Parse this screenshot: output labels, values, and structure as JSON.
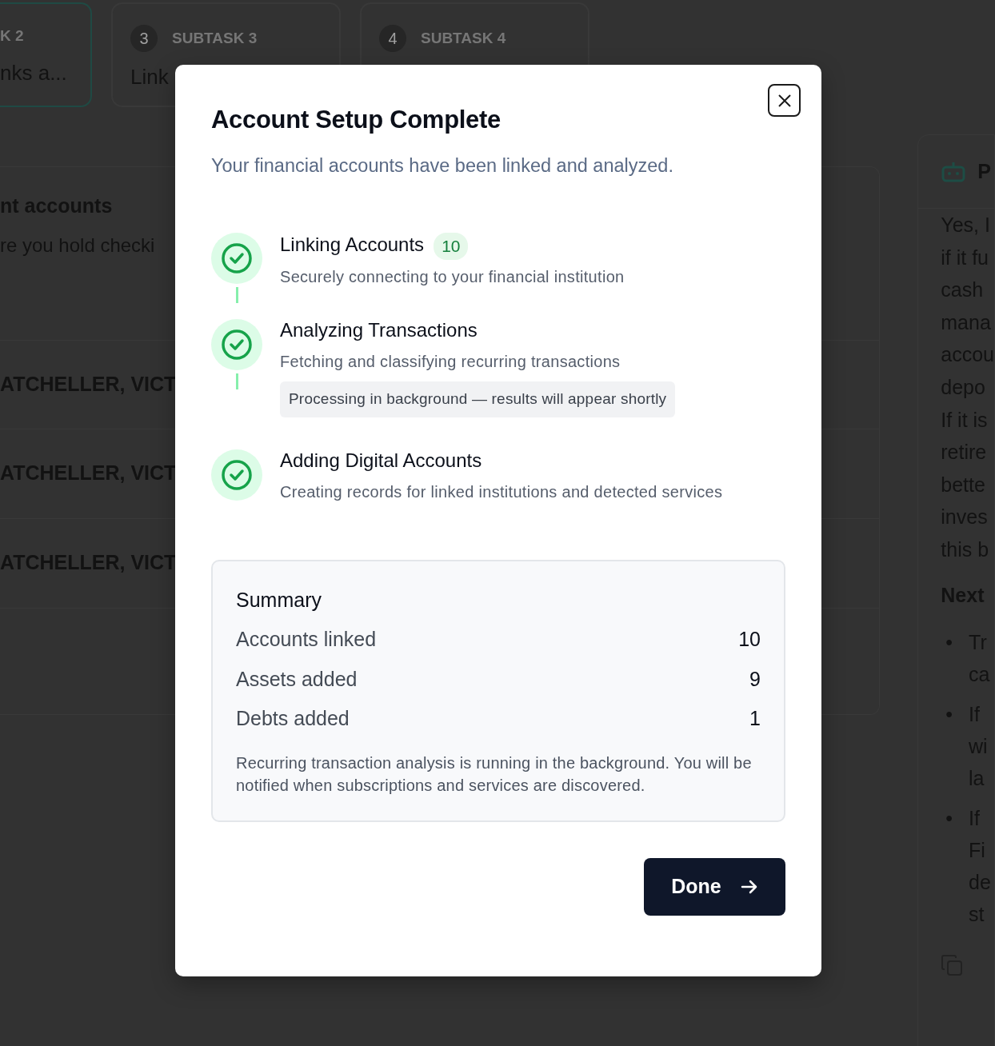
{
  "background": {
    "subtasks": [
      {
        "label": "K 2",
        "title": "nks a...",
        "selected": true
      },
      {
        "number": "3",
        "label": "SUBTASK 3",
        "title": "Link",
        "selected": false
      },
      {
        "number": "4",
        "label": "SUBTASK 4",
        "selected": false
      }
    ],
    "section": {
      "title": "nt accounts",
      "description": "re you hold checki"
    },
    "rows": [
      "ATCHELLER, VICT",
      "ATCHELLER, VICT",
      "ATCHELLER, VICT"
    ],
    "chat": {
      "title": "P",
      "paragraph_lines": [
        "Yes, I",
        "if it fu",
        "cash",
        "mana",
        "accou",
        "depo",
        "If it is",
        "retire",
        "bette",
        "inves",
        "this b"
      ],
      "heading": "Next",
      "bullets": [
        {
          "marker": "•",
          "lines": [
            "Tr",
            "ca"
          ]
        },
        {
          "marker": "•",
          "lines": [
            "If",
            "wi",
            "la"
          ]
        },
        {
          "marker": "•",
          "lines": [
            "If",
            "Fi",
            "de",
            "st"
          ]
        }
      ]
    }
  },
  "modal": {
    "title": "Account Setup Complete",
    "subtitle": "Your financial accounts have been linked and analyzed.",
    "steps": [
      {
        "title": "Linking Accounts",
        "count": "10",
        "description": "Securely connecting to your financial institution",
        "done": true
      },
      {
        "title": "Analyzing Transactions",
        "description": "Fetching and classifying recurring transactions",
        "note": "Processing in background — results will appear shortly",
        "done": true
      },
      {
        "title": "Adding Digital Accounts",
        "description": "Creating records for linked institutions and detected services",
        "done": true
      }
    ],
    "summary": {
      "title": "Summary",
      "rows": [
        {
          "label": "Accounts linked",
          "value": "10"
        },
        {
          "label": "Assets added",
          "value": "9"
        },
        {
          "label": "Debts added",
          "value": "1"
        }
      ],
      "note": "Recurring transaction analysis is running in the background. You will be notified when subscriptions and services are discovered."
    },
    "button": "Done"
  }
}
